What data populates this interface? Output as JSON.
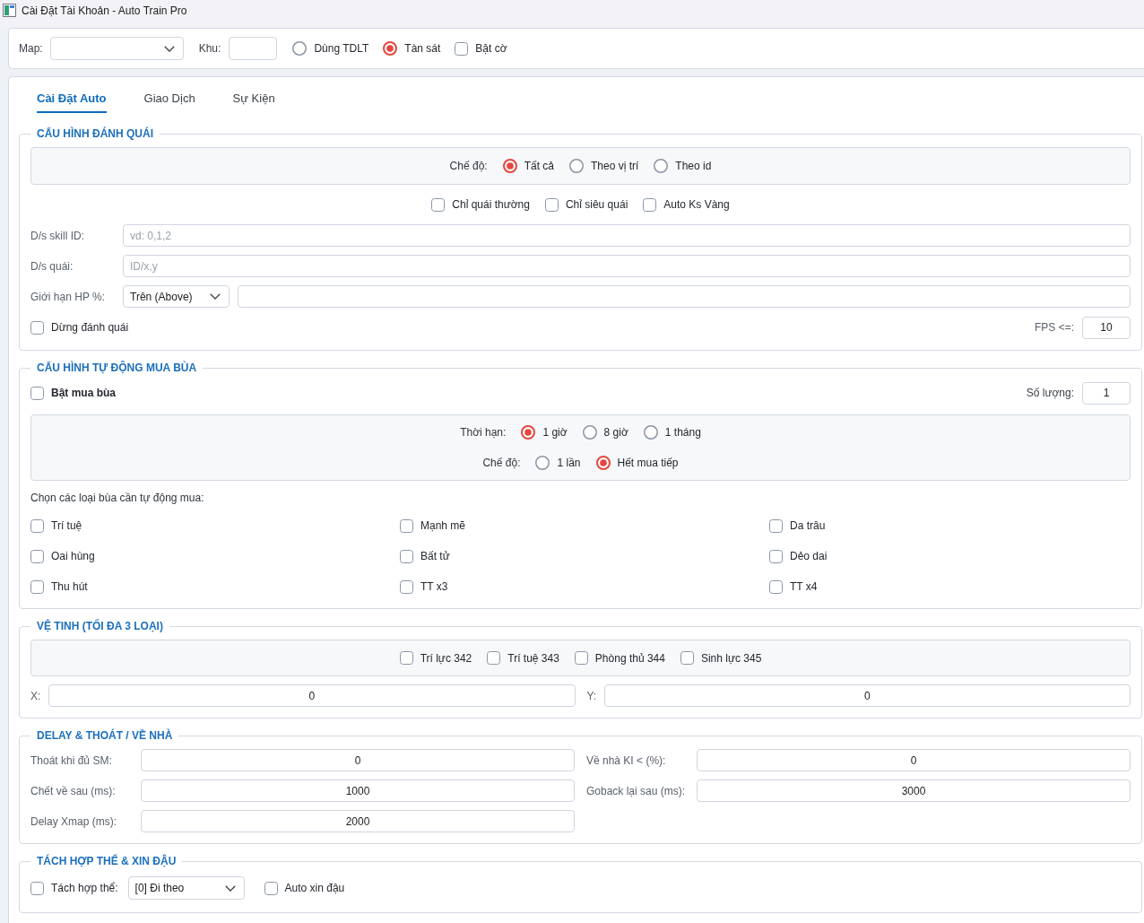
{
  "window": {
    "title": "Cài Đặt Tài Khoản - Auto Train Pro"
  },
  "top_bar": {
    "map": {
      "label": "Map:"
    },
    "zone": {
      "label": "Khu:"
    },
    "options": [
      {
        "kind": "radio",
        "label": "Dùng TDLT",
        "selected": false
      },
      {
        "kind": "radio",
        "label": "Tàn sát",
        "selected": true
      },
      {
        "kind": "checkbox",
        "label": "Bật cờ",
        "checked": false
      }
    ]
  },
  "tabs": [
    {
      "label": "Cài Đặt Auto",
      "selected": true
    },
    {
      "label": "Giao Dịch",
      "selected": false
    },
    {
      "label": "Sự Kiện",
      "selected": false
    }
  ],
  "attack_config": {
    "title": "CẤU HÌNH ĐÁNH QUÁI",
    "mode": {
      "label": "Chế độ:",
      "options": [
        {
          "label": "Tất cả",
          "selected": true
        },
        {
          "label": "Theo vị trí",
          "selected": false
        },
        {
          "label": "Theo id",
          "selected": false
        }
      ]
    },
    "filters": [
      {
        "label": "Chỉ quái thường",
        "checked": false
      },
      {
        "label": "Chỉ siêu quái",
        "checked": false
      },
      {
        "label": "Auto Ks Vàng",
        "checked": false
      }
    ],
    "skill_ids": {
      "label": "D/s skill ID:",
      "placeholder": "vd: 0,1,2"
    },
    "monsters": {
      "label": "D/s quái:",
      "placeholder": "ID/x,y"
    },
    "hp_limit": {
      "label": "Giới hạn HP %:",
      "mode": "Trên (Above)"
    },
    "stop_attack": {
      "label": "Dừng đánh quái",
      "checked": false
    },
    "fps": {
      "label": "FPS <=:",
      "value": "10"
    }
  },
  "charm_config": {
    "title": "CẤU HÌNH TỰ ĐỘNG MUA BÙA",
    "enable": {
      "label": "Bật mua bùa",
      "checked": false
    },
    "quantity": {
      "label": "Số lượng:",
      "value": "1"
    },
    "duration": {
      "label": "Thời hạn:",
      "options": [
        {
          "label": "1 giờ",
          "selected": true
        },
        {
          "label": "8 giờ",
          "selected": false
        },
        {
          "label": "1 tháng",
          "selected": false
        }
      ]
    },
    "mode": {
      "label": "Chế độ:",
      "options": [
        {
          "label": "1 lần",
          "selected": false
        },
        {
          "label": "Hết mua tiếp",
          "selected": true
        }
      ]
    },
    "list_label": "Chọn các loại bùa cần tự động mua:",
    "charms": [
      {
        "label": "Trí tuệ",
        "checked": false
      },
      {
        "label": "Mạnh mẽ",
        "checked": false
      },
      {
        "label": "Da trâu",
        "checked": false
      },
      {
        "label": "Oai hùng",
        "checked": false
      },
      {
        "label": "Bất tử",
        "checked": false
      },
      {
        "label": "Dẻo dai",
        "checked": false
      },
      {
        "label": "Thu hút",
        "checked": false
      },
      {
        "label": "TT x3",
        "checked": false
      },
      {
        "label": "TT x4",
        "checked": false
      }
    ]
  },
  "satellite": {
    "title": "VỆ TINH (TỐI ĐA 3 LOẠI)",
    "options": [
      {
        "label": "Trí lực 342",
        "checked": false
      },
      {
        "label": "Trí tuệ 343",
        "checked": false
      },
      {
        "label": "Phòng thủ 344",
        "checked": false
      },
      {
        "label": "Sinh lực 345",
        "checked": false
      }
    ],
    "x": {
      "label": "X:",
      "value": "0"
    },
    "y": {
      "label": "Y:",
      "value": "0"
    }
  },
  "delay": {
    "title": "DELAY & THOÁT / VỀ NHÀ",
    "fields": [
      {
        "label": "Thoát khi đủ SM:",
        "value": "0"
      },
      {
        "label": "Về nhà KI < (%):",
        "value": "0"
      },
      {
        "label": "Chết về sau (ms):",
        "value": "1000"
      },
      {
        "label": "Goback lại sau (ms):",
        "value": "3000"
      },
      {
        "label": "Delay Xmap (ms):",
        "value": "2000"
      }
    ]
  },
  "split": {
    "title": "TÁCH HỢP THỂ & XIN ĐẬU",
    "fusion_split": {
      "label": "Tách hợp thể:",
      "checked": false,
      "mode": "[0] Đi theo"
    },
    "auto_beans": {
      "label": "Auto xin đậu",
      "checked": false
    }
  }
}
